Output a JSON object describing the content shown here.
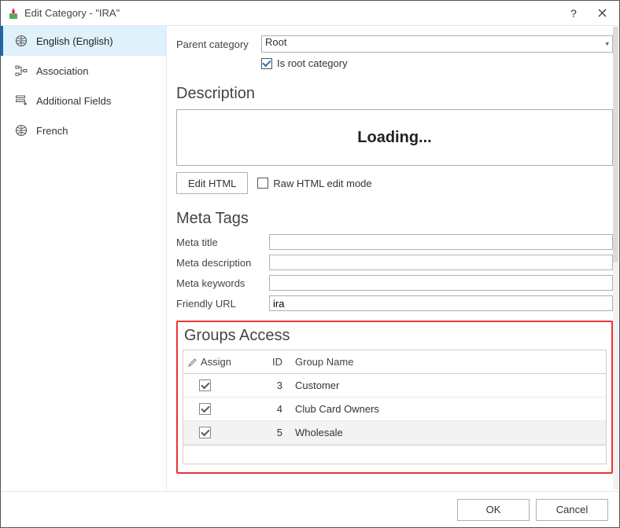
{
  "window": {
    "title": "Edit Category - \"IRA\"",
    "help": "?",
    "close": "✕"
  },
  "sidebar": {
    "items": [
      {
        "label": "English (English)"
      },
      {
        "label": "Association"
      },
      {
        "label": "Additional Fields"
      },
      {
        "label": "French"
      }
    ]
  },
  "main": {
    "parent_label": "Parent category",
    "parent_value": "Root",
    "is_root_label": "Is root category",
    "is_root_checked": true,
    "description_heading": "Description",
    "loading": "Loading...",
    "edit_html_btn": "Edit HTML",
    "raw_html_label": "Raw HTML edit mode",
    "meta_heading": "Meta Tags",
    "meta": {
      "title_label": "Meta title",
      "title_value": "",
      "description_label": "Meta description",
      "description_value": "",
      "keywords_label": "Meta keywords",
      "keywords_value": "",
      "url_label": "Friendly URL",
      "url_value": "ira"
    },
    "groups": {
      "heading": "Groups Access",
      "col_assign": "Assign",
      "col_id": "ID",
      "col_name": "Group Name",
      "rows": [
        {
          "id": "3",
          "name": "Customer",
          "checked": true
        },
        {
          "id": "4",
          "name": "Club Card Owners",
          "checked": true
        },
        {
          "id": "5",
          "name": "Wholesale",
          "checked": true,
          "selected": true
        }
      ]
    }
  },
  "footer": {
    "ok": "OK",
    "cancel": "Cancel"
  }
}
